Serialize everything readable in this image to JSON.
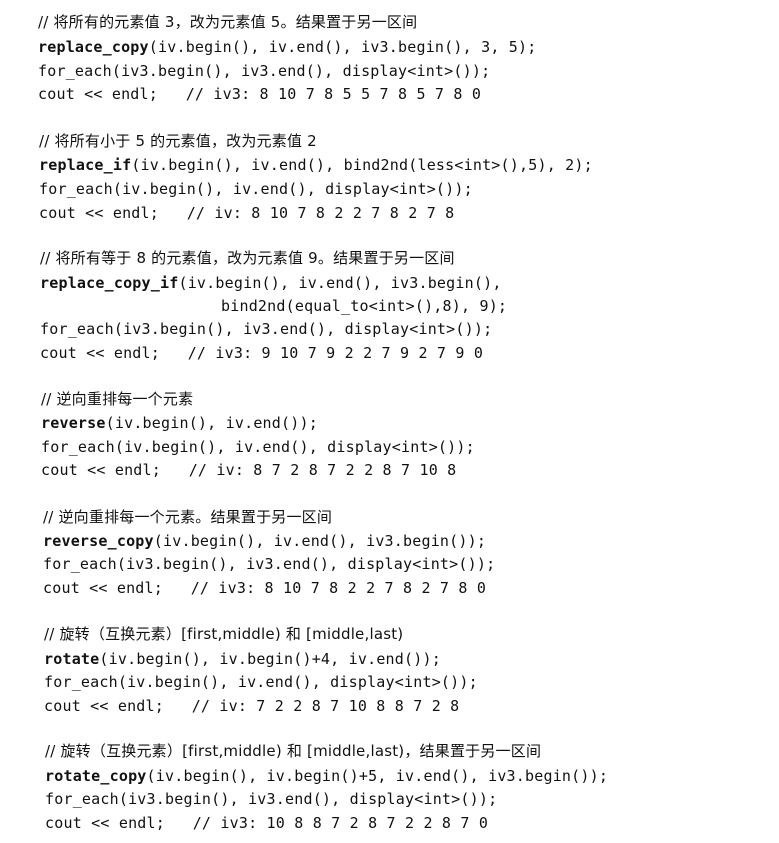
{
  "blocks": [
    {
      "comment": "// 将所有的元素值 3，改为元素值 5。结果置于另一区间",
      "call_fn": "replace_copy",
      "call_args": "(iv.begin(), iv.end(), iv3.begin(), 3, 5);",
      "continuation": "",
      "foreach": "for_each(iv3.begin(), iv3.end(), display<int>());",
      "cout": "cout << endl;   // iv3: 8 10 7 8 5 5 7 8 5 7 8 0"
    },
    {
      "comment": "// 将所有小于 5 的元素值，改为元素值 2",
      "call_fn": "replace_if",
      "call_args": "(iv.begin(), iv.end(), bind2nd(less<int>(),5), 2);",
      "continuation": "",
      "foreach": "for_each(iv.begin(), iv.end(), display<int>());",
      "cout": "cout << endl;   // iv: 8 10 7 8 2 2 7 8 2 7 8"
    },
    {
      "comment": "// 将所有等于 8 的元素值，改为元素值 9。结果置于另一区间",
      "call_fn": "replace_copy_if",
      "call_args": "(iv.begin(), iv.end(), iv3.begin(),",
      "continuation": "bind2nd(equal_to<int>(),8), 9);",
      "foreach": "for_each(iv3.begin(), iv3.end(), display<int>());",
      "cout": "cout << endl;   // iv3: 9 10 7 9 2 2 7 9 2 7 9 0"
    },
    {
      "comment": "// 逆向重排每一个元素",
      "call_fn": "reverse",
      "call_args": "(iv.begin(), iv.end());",
      "continuation": "",
      "foreach": "for_each(iv.begin(), iv.end(), display<int>());",
      "cout": "cout << endl;   // iv: 8 7 2 8 7 2 2 8 7 10 8"
    },
    {
      "comment": "// 逆向重排每一个元素。结果置于另一区间",
      "call_fn": "reverse_copy",
      "call_args": "(iv.begin(), iv.end(), iv3.begin());",
      "continuation": "",
      "foreach": "for_each(iv3.begin(), iv3.end(), display<int>());",
      "cout": "cout << endl;   // iv3: 8 10 7 8 2 2 7 8 2 7 8 0"
    },
    {
      "comment": "// 旋转（互换元素）[first,middle) 和 [middle,last)",
      "call_fn": "rotate",
      "call_args": "(iv.begin(), iv.begin()+4, iv.end());",
      "continuation": "",
      "foreach": "for_each(iv.begin(), iv.end(), display<int>());",
      "cout": "cout << endl;   // iv: 7 2 2 8 7 10 8 8 7 2 8"
    },
    {
      "comment": "// 旋转（互换元素）[first,middle) 和 [middle,last)，结果置于另一区间",
      "call_fn": "rotate_copy",
      "call_args": "(iv.begin(), iv.begin()+5, iv.end(), iv3.begin());",
      "continuation": "",
      "foreach": "for_each(iv3.begin(), iv3.end(), display<int>());",
      "cout": "cout << endl;   // iv3: 10 8 8 7 2 8 7 2 2 8 7 0"
    }
  ]
}
